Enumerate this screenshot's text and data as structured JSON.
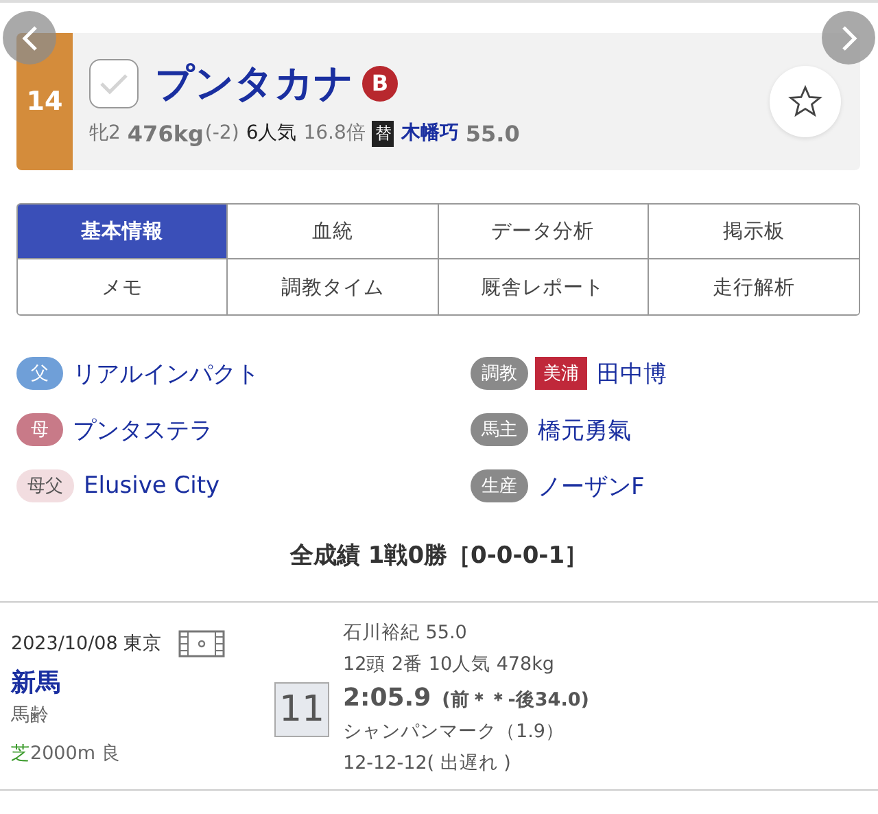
{
  "horse": {
    "number": "14",
    "checked": false,
    "name": "プンタカナ",
    "grade": "B",
    "sex_age": "牝2",
    "weight": "476kg",
    "weight_change": "(-2)",
    "popularity": "6人気",
    "odds": "16.8倍",
    "jockey_change": "替",
    "jockey": "木幡巧",
    "jockey_weight": "55.0",
    "favorite": false
  },
  "tabs": [
    {
      "label": "基本情報",
      "selected": true
    },
    {
      "label": "血統",
      "selected": false
    },
    {
      "label": "データ分析",
      "selected": false
    },
    {
      "label": "掲示板",
      "selected": false
    },
    {
      "label": "メモ",
      "selected": false
    },
    {
      "label": "調教タイム",
      "selected": false
    },
    {
      "label": "厩舎レポート",
      "selected": false
    },
    {
      "label": "走行解析",
      "selected": false
    }
  ],
  "pedigree": [
    {
      "label": "父",
      "color": "#6f9fd8",
      "value": "リアルインパクト"
    },
    {
      "label": "母",
      "color": "#c87a88",
      "value": "プンタステラ"
    },
    {
      "label": "母父",
      "color": "#f2dde0",
      "value": "Elusive City"
    }
  ],
  "connections": [
    {
      "label": "調教",
      "region": "美浦",
      "value": "田中博"
    },
    {
      "label": "馬主",
      "value": "橋元勇氣"
    },
    {
      "label": "生産",
      "value": "ノーザンF"
    }
  ],
  "summary": "全成績 1戦0勝［0-0-0-1］",
  "races": [
    {
      "date": "2023/10/08 東京",
      "class": "新馬",
      "condition": "馬齢",
      "surface": "芝",
      "distance": "2000m 良",
      "finish": "11",
      "jockey": "石川裕紀 55.0",
      "info": "12頭 2番 10人気 478kg",
      "time": "2:05.9",
      "pace": "(前＊＊-後34.0)",
      "winner": "シャンパンマーク（1.9）",
      "passing": "12-12-12( 出遅れ )"
    }
  ]
}
